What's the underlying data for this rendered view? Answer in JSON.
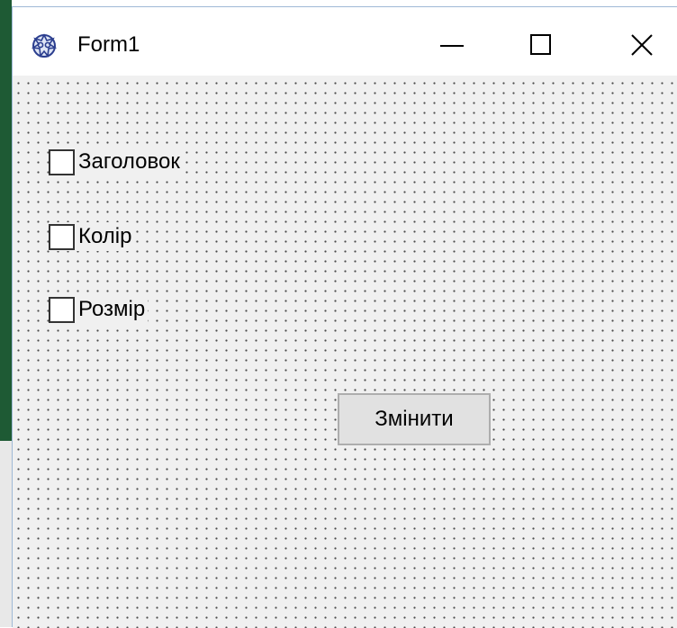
{
  "window": {
    "title": "Form1",
    "icon": "delphi-form-icon",
    "controls": {
      "minimize_icon": "minimize-icon",
      "maximize_icon": "maximize-icon",
      "close_icon": "close-icon"
    }
  },
  "form": {
    "checkboxes": [
      {
        "label": "Заголовок",
        "checked": false
      },
      {
        "label": "Колір",
        "checked": false
      },
      {
        "label": "Розмір",
        "checked": false
      }
    ],
    "button_label": "Змінити"
  },
  "colors": {
    "client_background": "#f0f0f0",
    "grid_dots": "#4a4a4a",
    "button_face": "#e1e1e1",
    "button_border": "#adadad",
    "outer_strip": "#1e5a34"
  }
}
